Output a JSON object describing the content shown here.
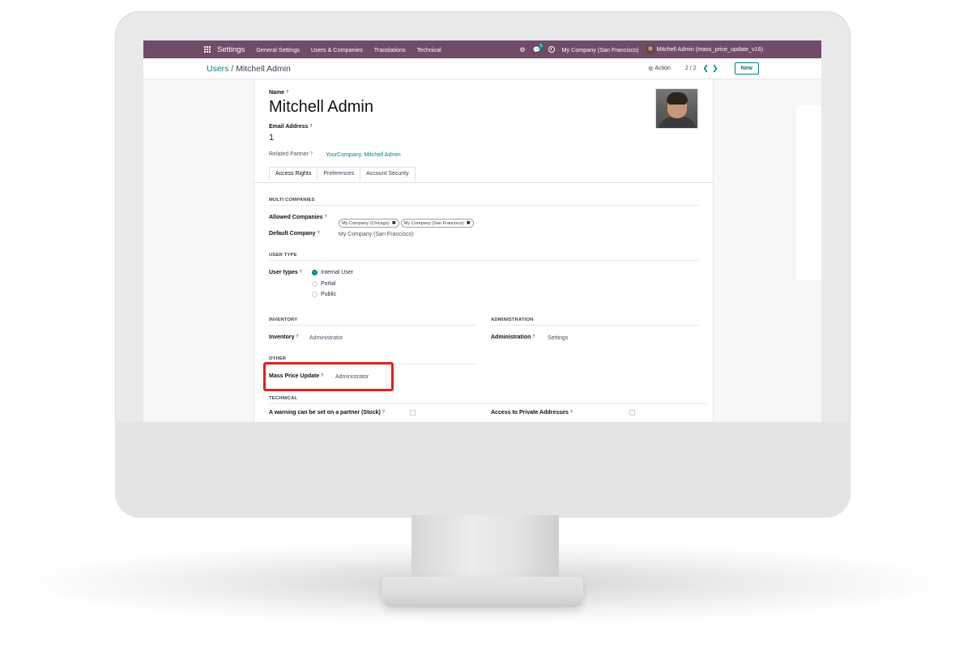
{
  "navbar": {
    "brand": "Settings",
    "menus": [
      "General Settings",
      "Users & Companies",
      "Translations",
      "Technical"
    ],
    "chat_count": "5",
    "company": "My Company (San Francisco)",
    "user": "Mitchell Admin (mass_price_update_v16)",
    "color": "#714b67"
  },
  "control": {
    "breadcrumb_parent": "Users",
    "breadcrumb_sep": "/",
    "breadcrumb_current": "Mitchell Admin",
    "action_label": "Action",
    "pager": "2 / 2",
    "new_label": "New"
  },
  "form": {
    "name_label": "Name",
    "name_value": "Mitchell Admin",
    "email_label": "Email Address",
    "email_value": "1",
    "related_partner_label": "Related Partner",
    "related_partner_value": "YourCompany, Mitchell Admin",
    "help_mark": "?"
  },
  "tabs": [
    "Access Rights",
    "Preferences",
    "Account Security"
  ],
  "multi_companies": {
    "heading": "MULTI COMPANIES",
    "allowed_label": "Allowed Companies",
    "allowed_tags": [
      "My Company (Chicago)",
      "My Company (San Francisco)"
    ],
    "default_label": "Default Company",
    "default_value": "My Company (San Francisco)"
  },
  "user_type": {
    "heading": "USER TYPE",
    "label": "User types",
    "options": [
      "Internal User",
      "Portal",
      "Public"
    ],
    "selected": "Internal User"
  },
  "inventory": {
    "heading": "INVENTORY",
    "label": "Inventory",
    "value": "Administrator"
  },
  "administration": {
    "heading": "ADMINISTRATION",
    "label": "Administration",
    "value": "Settings"
  },
  "other": {
    "heading": "OTHER",
    "label": "Mass Price Update",
    "value": "Administrator"
  },
  "technical": {
    "heading": "TECHNICAL",
    "field1": "A warning can be set on a partner (Stock)",
    "field2": "Access to Private Addresses"
  },
  "highlight_color": "#e0201b"
}
